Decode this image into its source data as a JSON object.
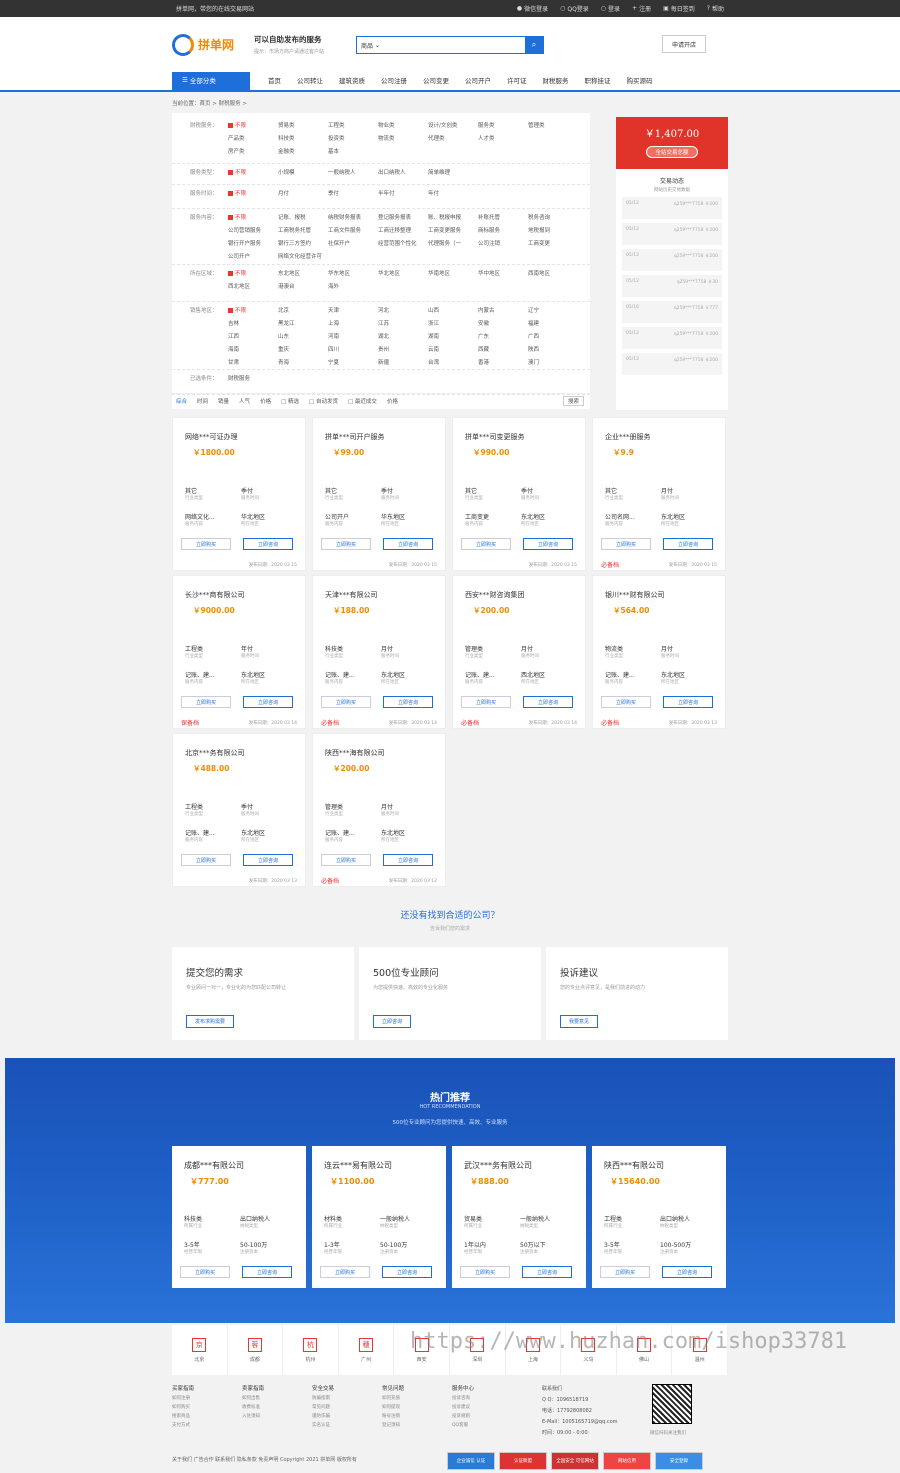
{
  "top": {
    "welcome": "拼单网，带您的在线交易网站",
    "links": [
      "微信登录",
      "QQ登录",
      "登录",
      "注册",
      "每日签到",
      "帮助"
    ]
  },
  "header": {
    "logo": "拼单网",
    "slogan": "可以自助发布的服务",
    "tip": "提示：市场方商户请通过客户站",
    "search_sel": "商品",
    "open_btn": "申请开店"
  },
  "nav": {
    "cat": "全部分类",
    "items": [
      "首页",
      "公司转让",
      "建筑资质",
      "公司注册",
      "公司变更",
      "公司开户",
      "许可证",
      "财税服务",
      "职称挂证",
      "购买源码"
    ]
  },
  "crumb": "当前位置：首页 > 财税服务 >",
  "filters": [
    {
      "label": "财税服务：",
      "opts": [
        "不限",
        "贸易类",
        "工程类",
        "物业类",
        "设计/文创类",
        "服务类",
        "管理类",
        "产品类",
        "科技类",
        "投资类",
        "物流类",
        "代理类",
        "人才类",
        "",
        "房产类",
        "金融类",
        "基本"
      ]
    },
    {
      "label": "服务类型：",
      "opts": [
        "不限",
        "小规模",
        "一般纳税人",
        "出口纳税人",
        "简单维理"
      ]
    },
    {
      "label": "服务时间：",
      "opts": [
        "不限",
        "月付",
        "季付",
        "半年付",
        "年付"
      ]
    },
    {
      "label": "服务内容：",
      "opts": [
        "不限",
        "记账、报税",
        "纳税财务报表",
        "登记服务报表",
        "账、税报申报",
        "补账托管",
        "税务咨询",
        "公司营销服务",
        "工商税务托管",
        "工商文件服务",
        "工商迁移整理",
        "工商变更服务",
        "商标服务",
        "地税报到",
        "银行开户服务",
        "银行三方签约",
        "社保开户",
        "经营范围个性化",
        "代理服务（一",
        "公司注销",
        "工商变更",
        "公司开户",
        "网络文化经营许可"
      ]
    },
    {
      "label": "所在区域：",
      "opts": [
        "不限",
        "东北地区",
        "华东地区",
        "华北地区",
        "华南地区",
        "华中地区",
        "西南地区",
        "西北地区",
        "港澳台",
        "海外"
      ]
    },
    {
      "label": "销售地区：",
      "opts": [
        "不限",
        "北京",
        "天津",
        "河北",
        "山西",
        "内蒙古",
        "辽宁",
        "吉林",
        "黑龙江",
        "上海",
        "江苏",
        "浙江",
        "安徽",
        "福建",
        "江西",
        "山东",
        "河南",
        "湖北",
        "湖南",
        "广东",
        "广西",
        "海南",
        "重庆",
        "四川",
        "贵州",
        "云南",
        "西藏",
        "陕西",
        "甘肃",
        "青海",
        "宁夏",
        "新疆",
        "台湾",
        "香港",
        "澳门"
      ]
    },
    {
      "label": "已选条件：",
      "opts": [
        "财税服务"
      ]
    }
  ],
  "sortbar": {
    "items": [
      "综合",
      "时间",
      "销量",
      "人气",
      "价格",
      "□ 精选",
      "□ 自动发货",
      "□ 最近成交",
      "价格"
    ],
    "search_btn": "搜索"
  },
  "side": {
    "price": "￥1,407.00",
    "btn": "全站交易总额",
    "title": "交易动态",
    "sub": "网站历史交易数据",
    "trades": [
      [
        "05/12",
        "q259***7758 ￥200"
      ],
      [
        "05/12",
        "q259***7758 ￥200"
      ],
      [
        "05/12",
        "q259***7758 ￥200"
      ],
      [
        "05/12",
        "q259***7758 ￥30"
      ],
      [
        "05/16",
        "q259***7758 ￥777"
      ],
      [
        "05/12",
        "q259***7758 ￥200"
      ],
      [
        "05/12",
        "q259***7758 ￥200"
      ]
    ]
  },
  "cards": [
    {
      "t": "网络***可证办理",
      "p": "￥1800.00",
      "f": [
        "其它",
        "季付",
        "网络文化...",
        "华北地区"
      ],
      "d": "发布日期：2020 03 15",
      "tag": ""
    },
    {
      "t": "拼单***司开户服务",
      "p": "￥99.00",
      "f": [
        "其它",
        "季付",
        "公司开户",
        "华东地区"
      ],
      "d": "发布日期：2020 03 15",
      "tag": ""
    },
    {
      "t": "拼单***司变更服务",
      "p": "￥990.00",
      "f": [
        "其它",
        "季付",
        "工商变更",
        "东北地区"
      ],
      "d": "发布日期：2020 03 15",
      "tag": ""
    },
    {
      "t": "企业***册服务",
      "p": "￥9.9",
      "f": [
        "其它",
        "月付",
        "公司名网...",
        "东北地区"
      ],
      "d": "发布日期：2020 03 15",
      "tag": "必备档"
    },
    {
      "t": "长沙***商有限公司",
      "p": "￥9000.00",
      "f": [
        "工程类",
        "年付",
        "记账、建...",
        "东北地区"
      ],
      "d": "发布日期：2020 03 14",
      "tag": "保备档"
    },
    {
      "t": "天津***有限公司",
      "p": "￥188.00",
      "f": [
        "科技类",
        "月付",
        "记账、建...",
        "东北地区"
      ],
      "d": "发布日期：2020 03 14",
      "tag": "必备档"
    },
    {
      "t": "西安***财咨询集团",
      "p": "￥200.00",
      "f": [
        "管理类",
        "月付",
        "记账、建...",
        "西北地区"
      ],
      "d": "发布日期：2020 03 14",
      "tag": "必备档"
    },
    {
      "t": "银川***财有限公司",
      "p": "￥564.00",
      "f": [
        "物流类",
        "月付",
        "记账、建...",
        "东北地区"
      ],
      "d": "发布日期：2020 03 13",
      "tag": "必备档"
    },
    {
      "t": "北京***务有限公司",
      "p": "￥488.00",
      "f": [
        "工程类",
        "季付",
        "记账、建...",
        "东北地区"
      ],
      "d": "发布日期：2020 03 13",
      "tag": ""
    },
    {
      "t": "陕西***海有限公司",
      "p": "￥200.00",
      "f": [
        "管理类",
        "月付",
        "记账、建...",
        "东北地区"
      ],
      "d": "发布日期：2020 03 12",
      "tag": "必备档"
    }
  ],
  "card_labels": {
    "k1": "行业类型",
    "k2": "服务时间",
    "k3": "服务内容",
    "k4": "所在地区",
    "b1": "立即购买",
    "b2": "立即咨询"
  },
  "more": {
    "a": "还没有找到合适的公司？",
    "b": "告诉我们您的需求"
  },
  "svc": [
    {
      "h": "提交您的需求",
      "d": "专业顾问一对一，专业化的为您匹配公司转让",
      "bt": "发布求购需要"
    },
    {
      "h": "500位专业顾问",
      "d": "为您提供快速、高效的专业化服务",
      "bt": "立即咨询"
    },
    {
      "h": "投诉建议",
      "d": "您的专业点评意见，是我们前进的动力",
      "bt": "我要意见"
    }
  ],
  "hot": {
    "h": "热门推荐",
    "e": "HOT RECOMMENDATION",
    "s": "500位专业顾问为您提供快速、高效、专业服务",
    "cards": [
      {
        "t": "成都***有限公司",
        "p": "￥777.00",
        "f": [
          "科技类",
          "出口纳税人",
          "3-5年",
          "50-100万"
        ]
      },
      {
        "t": "连云***易有限公司",
        "p": "￥1100.00",
        "f": [
          "材料类",
          "一般纳税人",
          "1-3年",
          "50-100万"
        ]
      },
      {
        "t": "武汉***务有限公司",
        "p": "￥888.00",
        "f": [
          "贸易类",
          "一般纳税人",
          "1年以内",
          "50万以下"
        ]
      },
      {
        "t": "陕西***有限公司",
        "p": "￥15640.00",
        "f": [
          "工程类",
          "出口纳税人",
          "3-5年",
          "100-500万"
        ]
      }
    ],
    "labels": [
      "所属行业",
      "纳税类型",
      "经营年限",
      "注册资本"
    ]
  },
  "cities": [
    [
      "京",
      "北京"
    ],
    [
      "蓉",
      "成都"
    ],
    [
      "杭",
      "杭州"
    ],
    [
      "穗",
      "广州"
    ],
    [
      "",
      "西安"
    ],
    [
      "",
      "深圳"
    ],
    [
      "",
      "上海"
    ],
    [
      "",
      "义乌"
    ],
    [
      "",
      "佛山"
    ],
    [
      "",
      "温州"
    ]
  ],
  "footer": {
    "cols": [
      {
        "h": "买家指南",
        "i": [
          "如何注册",
          "如何购买",
          "搜索商品",
          "支付方式"
        ]
      },
      {
        "h": "卖家指南",
        "i": [
          "如何出售",
          "收费标准",
          "入驻须知"
        ]
      },
      {
        "h": "安全交易",
        "i": [
          "防骗指南",
          "常见问题",
          "谨防诈骗",
          "实名认证"
        ]
      },
      {
        "h": "常见问题",
        "i": [
          "如何充值",
          "如何提现",
          "账号注销",
          "登记须知"
        ]
      },
      {
        "h": "服务中心",
        "i": [
          "投诉咨询",
          "投诉建议",
          "投诉规则",
          "QQ客服"
        ]
      }
    ],
    "contact": [
      "联系我们",
      "Q Q：1096518719",
      "电话：17792808082",
      "E-Mail：1005165719@qq.com",
      "时间：09:00 - 0:00"
    ],
    "qr": "微信扫码关注我们",
    "copy": "关于我们   广告合作   联系我们   隐私条款   免责声明   Copyright 2021 拼单网 版权所有",
    "badges": [
      "企业诚信 认证",
      "认证联盟",
      "全国安全 可信网站",
      "网站信用",
      "安全登録"
    ]
  },
  "watermark": "https://www.huzhan.com/ishop33781"
}
